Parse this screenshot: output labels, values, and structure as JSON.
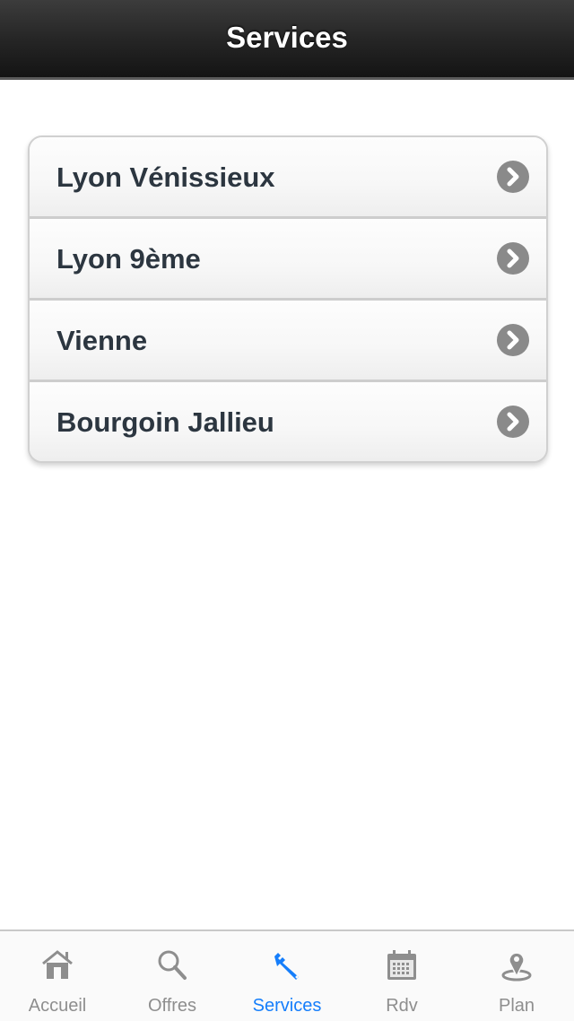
{
  "header": {
    "title": "Services"
  },
  "list": {
    "items": [
      {
        "label": "Lyon Vénissieux"
      },
      {
        "label": "Lyon 9ème"
      },
      {
        "label": "Vienne"
      },
      {
        "label": "Bourgoin Jallieu"
      }
    ],
    "accessory_icon": "chevron-right-circle-icon"
  },
  "tabbar": {
    "active_color": "#157efb",
    "inactive_color": "#8e8e8e",
    "active_tab": "Services",
    "tabs": [
      {
        "label": "Accueil",
        "icon": "home-icon"
      },
      {
        "label": "Offres",
        "icon": "search-icon"
      },
      {
        "label": "Services",
        "icon": "wrench-icon"
      },
      {
        "label": "Rdv",
        "icon": "calendar-icon"
      },
      {
        "label": "Plan",
        "icon": "map-pin-icon"
      }
    ]
  }
}
